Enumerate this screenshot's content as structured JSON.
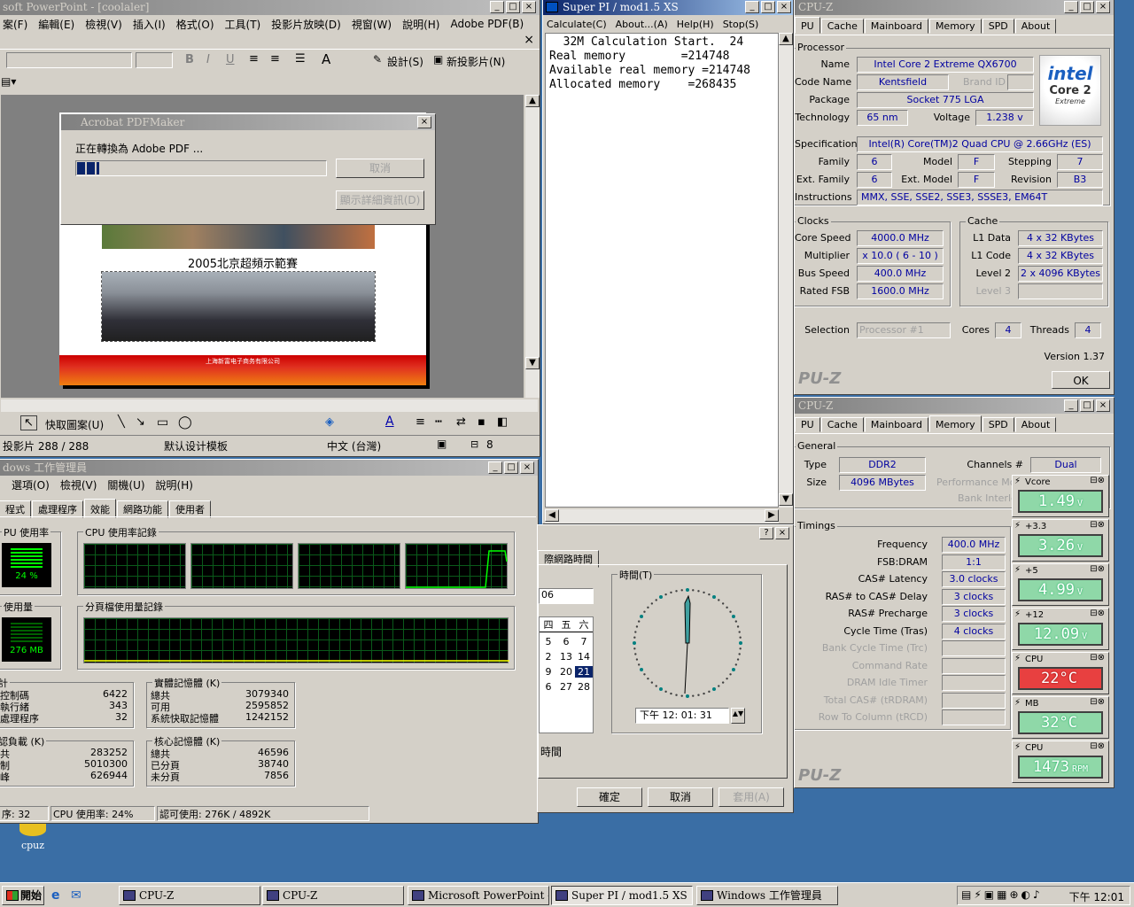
{
  "ppt": {
    "title": "soft PowerPoint - [coolaler]",
    "menu": [
      "案(F)",
      "編輯(E)",
      "檢視(V)",
      "插入(I)",
      "格式(O)",
      "工具(T)",
      "投影片放映(D)",
      "視窗(W)",
      "說明(H)",
      "Adobe PDF(B)"
    ],
    "design_btn": "設計(S)",
    "new_slide": "新投影片(N)",
    "draw_label": "快取圖案(U)",
    "status": [
      "投影片 288 / 288",
      "默认设计模板",
      "中文 (台灣)"
    ],
    "zoom": "8",
    "slide_caption": "2005北京超頻示範賽",
    "footer_company": "上海新富电子商务有限公司"
  },
  "pdfmaker": {
    "title": "Acrobat PDFMaker",
    "message": "正在轉換為 Adobe PDF ...",
    "progress": 0.09,
    "cancel": "取消",
    "details": "顯示詳細資訊(D)"
  },
  "taskmgr": {
    "title": "dows 工作管理員",
    "menu": [
      "選項(O)",
      "檢視(V)",
      "關機(U)",
      "說明(H)"
    ],
    "tabs": [
      "程式",
      "處理程序",
      "效能",
      "網路功能",
      "使用者"
    ],
    "cpu_usage_title": "PU 使用率",
    "cpu_history_title": "CPU 使用率記錄",
    "cpu_pct": "24 %",
    "mem_title": "使用量",
    "pf_history_title": "分頁檔使用量記錄",
    "pf_value": "276 MB",
    "totals": {
      "title": "計",
      "rows": [
        [
          "控制碼",
          "6422"
        ],
        [
          "執行緒",
          "343"
        ],
        [
          "處理程序",
          "32"
        ]
      ]
    },
    "physical": {
      "title": "實體記憶體 (K)",
      "rows": [
        [
          "總共",
          "3079340"
        ],
        [
          "可用",
          "2595852"
        ],
        [
          "系統快取記憶體",
          "1242152"
        ]
      ]
    },
    "commit": {
      "title": "認負載 (K)",
      "rows": [
        [
          "共",
          "283252"
        ],
        [
          "制",
          "5010300"
        ],
        [
          "峰",
          "626944"
        ]
      ]
    },
    "kernel": {
      "title": "核心記憶體 (K)",
      "rows": [
        [
          "總共",
          "46596"
        ],
        [
          "已分頁",
          "38740"
        ],
        [
          "未分頁",
          "7856"
        ]
      ]
    },
    "status": [
      "序: 32",
      "CPU 使用率: 24%",
      "認可使用: 276K / 4892K"
    ]
  },
  "superpi": {
    "title": "Super PI / mod1.5 XS",
    "menu": [
      "Calculate(C)",
      "About...(A)",
      "Help(H)",
      "Stop(S)"
    ],
    "lines": [
      "  32M Calculation Start.  24",
      "Real memory        =214748",
      "Available real memory =214748",
      "Allocated memory    =268435"
    ]
  },
  "datetime": {
    "tab": "際網路時間",
    "year_value": "06",
    "time_group": "時間(T)",
    "week_header": [
      "四",
      "五",
      "六"
    ],
    "calendar": [
      [
        "5",
        "6",
        "7"
      ],
      [
        "2",
        "13",
        "14"
      ],
      [
        "9",
        "20",
        "21"
      ],
      [
        "6",
        "27",
        "28"
      ]
    ],
    "selected_day": "21",
    "time_value": "下午   12: 01: 31",
    "footer_label": "時間",
    "ok": "確定",
    "cancel": "取消",
    "apply": "套用(A)"
  },
  "cpuz1": {
    "title": "CPU-Z",
    "tabs": [
      "PU",
      "Cache",
      "Mainboard",
      "Memory",
      "SPD",
      "About"
    ],
    "processor_group": "Processor",
    "name_label": "Name",
    "name": "Intel Core 2 Extreme QX6700",
    "codename_label": "Code Name",
    "codename": "Kentsfield",
    "brand_label": "Brand ID",
    "package_label": "Package",
    "package": "Socket 775 LGA",
    "tech_label": "Technology",
    "tech": "65 nm",
    "voltage_label": "Voltage",
    "voltage": "1.238 v",
    "spec_label": "Specification",
    "spec": "Intel(R) Core(TM)2 Quad CPU      @ 2.66GHz (ES)",
    "family_label": "Family",
    "family": "6",
    "model_label": "Model",
    "model": "F",
    "stepping_label": "Stepping",
    "stepping": "7",
    "extfam_label": "Ext. Family",
    "extfam": "6",
    "extmodel_label": "Ext. Model",
    "extmodel": "F",
    "revision_label": "Revision",
    "revision": "B3",
    "instr_label": "Instructions",
    "instr": "MMX, SSE, SSE2, SSE3, SSSE3, EM64T",
    "clocks_group": "Clocks",
    "core_speed_label": "Core Speed",
    "core_speed": "4000.0 MHz",
    "mult_label": "Multiplier",
    "mult": "x 10.0 ( 6 - 10 )",
    "bus_label": "Bus Speed",
    "bus": "400.0 MHz",
    "fsb_label": "Rated FSB",
    "fsb": "1600.0 MHz",
    "cache_group": "Cache",
    "l1d_label": "L1 Data",
    "l1d": "4 x 32 KBytes",
    "l1c_label": "L1 Code",
    "l1c": "4 x 32 KBytes",
    "l2_label": "Level 2",
    "l2": "2 x 4096 KBytes",
    "l3_label": "Level 3",
    "selection_label": "Selection",
    "selection": "Processor #1",
    "cores_label": "Cores",
    "cores": "4",
    "threads_label": "Threads",
    "threads": "4",
    "version": "Version 1.37",
    "ok": "OK",
    "brand_logo": "PU-Z",
    "intel_text": "intel",
    "core2_text": "Core 2",
    "extreme_text": "Extreme"
  },
  "cpuz2": {
    "title": "CPU-Z",
    "tabs": [
      "PU",
      "Cache",
      "Mainboard",
      "Memory",
      "SPD",
      "About"
    ],
    "general_group": "General",
    "type_label": "Type",
    "type": "DDR2",
    "channels_label": "Channels #",
    "channels": "Dual",
    "size_label": "Size",
    "size": "4096 MBytes",
    "perf_label": "Performance Mo",
    "bank_label": "Bank Interlea",
    "timings_group": "Timings",
    "timings": [
      [
        "Frequency",
        "400.0 MHz"
      ],
      [
        "FSB:DRAM",
        "1:1"
      ],
      [
        "CAS# Latency",
        "3.0 clocks"
      ],
      [
        "RAS# to CAS# Delay",
        "3 clocks"
      ],
      [
        "RAS# Precharge",
        "3 clocks"
      ],
      [
        "Cycle Time (Tras)",
        "4 clocks"
      ],
      [
        "Bank Cycle Time (Trc)",
        ""
      ],
      [
        "Command Rate",
        ""
      ],
      [
        "DRAM Idle Timer",
        ""
      ],
      [
        "Total CAS# (tRDRAM)",
        ""
      ],
      [
        "Row To Column (tRCD)",
        ""
      ]
    ],
    "brand_logo": "PU-Z"
  },
  "monitors": [
    {
      "label": "Vcore",
      "value": "1.49",
      "unit": "V"
    },
    {
      "label": "+3.3",
      "value": "3.26",
      "unit": "V"
    },
    {
      "label": "+5",
      "value": "4.99",
      "unit": "V"
    },
    {
      "label": "+12",
      "value": "12.09",
      "unit": "V"
    },
    {
      "label": "CPU",
      "value": "22°C",
      "unit": ""
    },
    {
      "label": "MB",
      "value": "32°C",
      "unit": ""
    },
    {
      "label": "CPU",
      "value": "1473",
      "unit": "RPM"
    }
  ],
  "desktop": {
    "icon_label": "cpuz"
  },
  "taskbar": {
    "start": "開始",
    "items": [
      "CPU-Z",
      "CPU-Z",
      "Microsoft PowerPoint - [c...",
      "Super PI / mod1.5 XS",
      "Windows 工作管理員"
    ],
    "clock": "下午 12:01"
  },
  "colors": {
    "desktop": "#3a6ea5",
    "title_active": "#0a246a",
    "value_text": "#0000a0",
    "graph_line": "#00ff00"
  }
}
